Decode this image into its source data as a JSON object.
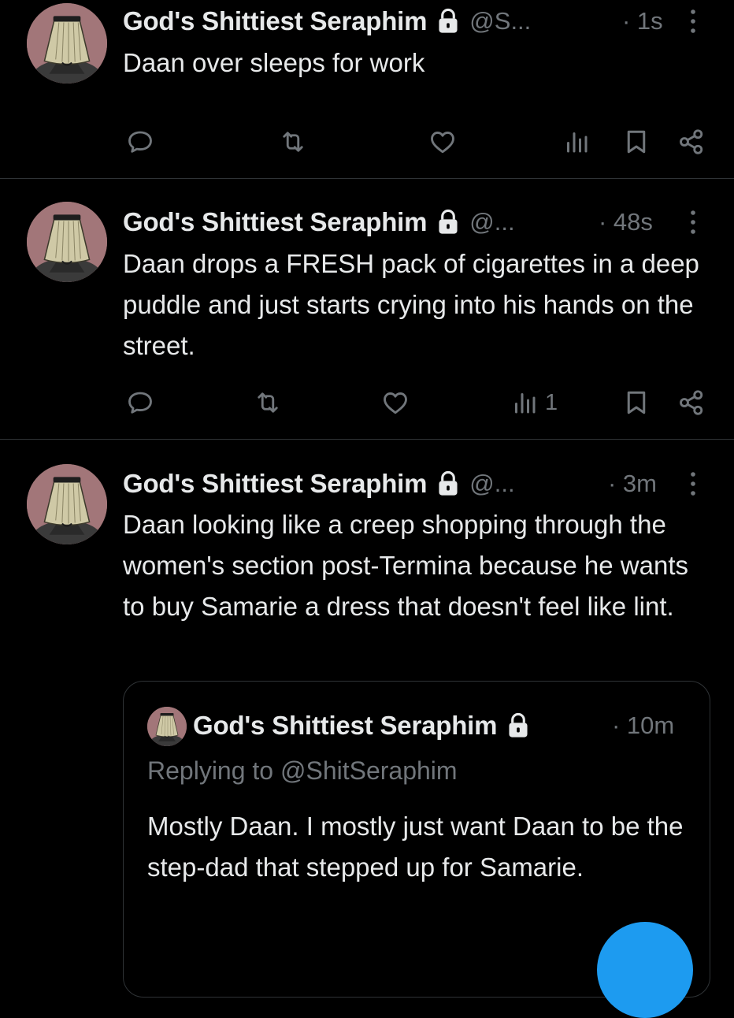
{
  "colors": {
    "background": "#000000",
    "text_primary": "#e7e9ea",
    "text_secondary": "#71767b",
    "divider": "#2f3336",
    "accent": "#1d9bf0"
  },
  "tweets": [
    {
      "name": "God's Shittiest Seraphim",
      "handle": "@S...",
      "time": "· 1s",
      "text": "Daan over sleeps for work",
      "views": ""
    },
    {
      "name": "God's Shittiest Seraphim",
      "handle": "@...",
      "time": "· 48s",
      "text": "Daan drops a FRESH pack of cigarettes in a deep puddle and just starts crying into his hands on the street.",
      "views": "1"
    },
    {
      "name": "God's Shittiest Seraphim",
      "handle": "@...",
      "time": "· 3m",
      "text": "Daan looking like a creep shopping through the women's section post-Termina because he wants to buy Samarie a dress that doesn't feel like lint.",
      "quote": {
        "name": "God's Shittiest Seraphim",
        "time": "· 10m",
        "replying_to": "Replying to @ShitSeraphim",
        "text": "Mostly Daan. I mostly just want Daan to be the step-dad that stepped up for Samarie."
      }
    }
  ],
  "icons": {
    "lock": "lock-icon",
    "more": "more-vertical-icon",
    "reply": "reply-icon",
    "retweet": "retweet-icon",
    "like": "heart-icon",
    "views": "views-icon",
    "bookmark": "bookmark-icon",
    "share": "share-icon",
    "compose": "compose-fab"
  }
}
